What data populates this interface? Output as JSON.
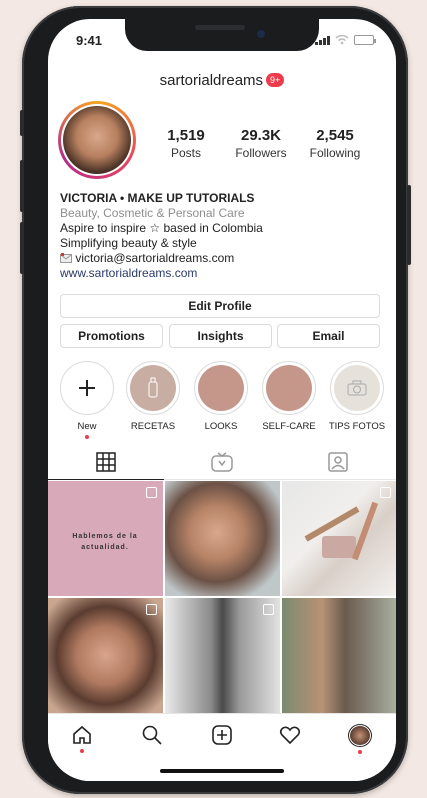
{
  "status_bar": {
    "time": "9:41"
  },
  "profile": {
    "username": "sartorialdreams",
    "notification_badge": "9+",
    "stats": [
      {
        "value": "1,519",
        "label": "Posts"
      },
      {
        "value": "29.3K",
        "label": "Followers"
      },
      {
        "value": "2,545",
        "label": "Following"
      }
    ],
    "bio": {
      "name": "VICTORIA • MAKE UP TUTORIALS",
      "category": "Beauty, Cosmetic & Personal Care",
      "line1": "Aspire to inspire ☆ based in Colombia",
      "line2": "Simplifying beauty & style",
      "email": "victoria@sartorialdreams.com",
      "website": "www.sartorialdreams.com"
    }
  },
  "buttons": {
    "edit_profile": "Edit Profile",
    "promotions": "Promotions",
    "insights": "Insights",
    "email": "Email"
  },
  "highlights": [
    {
      "label": "New"
    },
    {
      "label": "RECETAS"
    },
    {
      "label": "LOOKS"
    },
    {
      "label": "SELF-CARE"
    },
    {
      "label": "TIPS FOTOS"
    }
  ],
  "tabs": [
    {
      "name": "grid-icon"
    },
    {
      "name": "igtv-icon"
    },
    {
      "name": "tagged-icon"
    }
  ],
  "posts": [
    {
      "text": "Hablemos de la actualidad."
    }
  ],
  "colors": {
    "accent_red": "#ed3b4e",
    "highlight_tan": "#c4978a",
    "post_pink": "#d8aab9"
  }
}
